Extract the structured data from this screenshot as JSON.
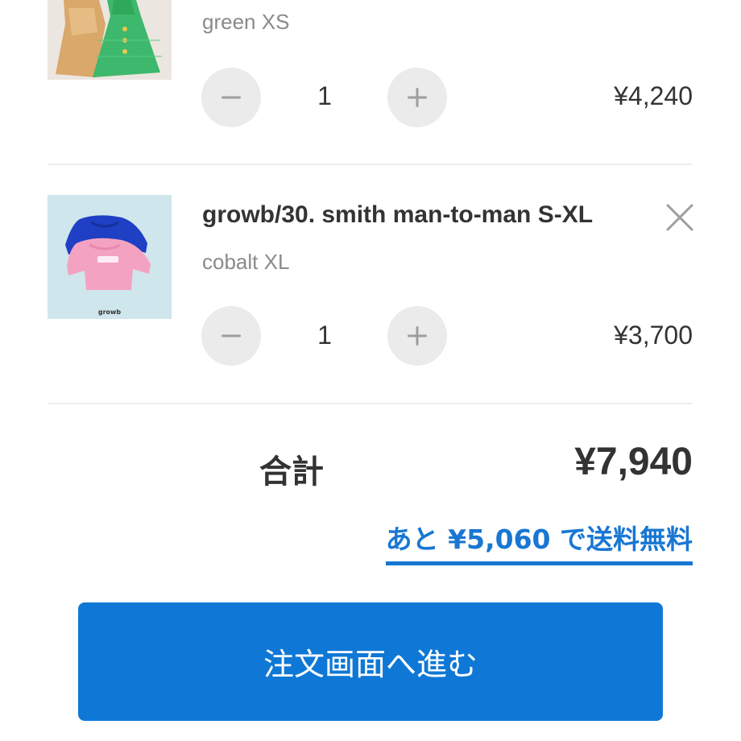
{
  "cart": {
    "items": [
      {
        "variant": "green XS",
        "quantity": "1",
        "price": "¥4,240",
        "image_icon": "dress-photo"
      },
      {
        "title": "growb/30. smith man-to-man S-XL",
        "variant": "cobalt XL",
        "quantity": "1",
        "price": "¥3,700",
        "image_icon": "sweatshirt-photo",
        "image_logo_text": "growb"
      }
    ],
    "total_label": "合計",
    "total_value": "¥7,940",
    "free_shipping_text": "あと ¥5,060 で送料無料",
    "checkout_label": "注文画面へ進む"
  },
  "colors": {
    "accent": "#1877d3",
    "button": "#0f78d6",
    "stepper_bg": "#ebebeb",
    "divider": "#eeeeee"
  }
}
